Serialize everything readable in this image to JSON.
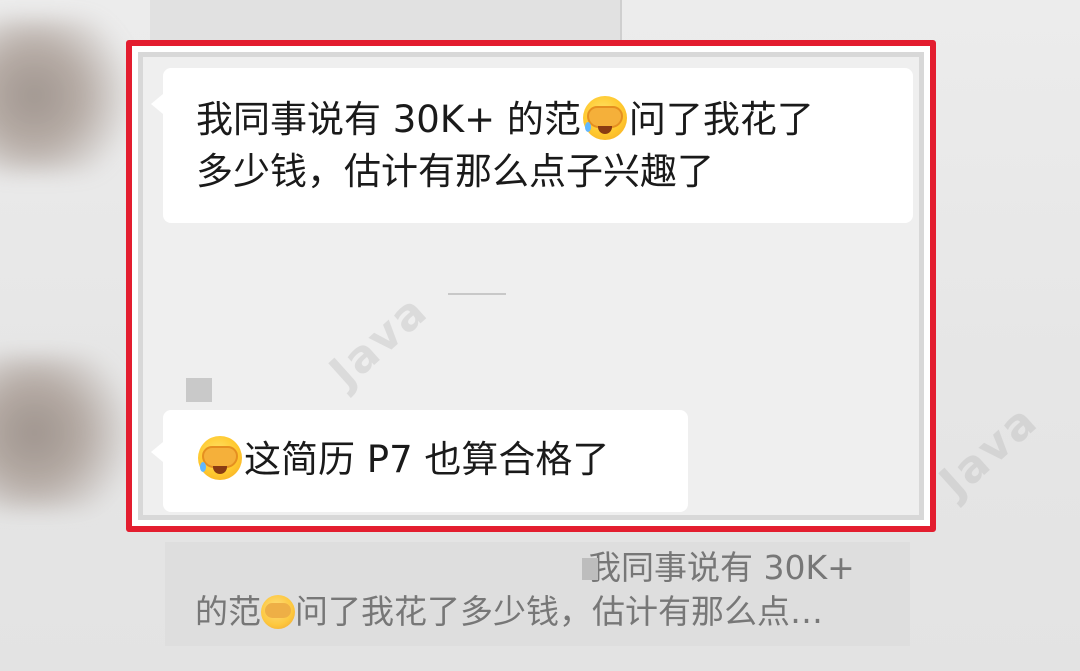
{
  "messages": [
    {
      "text_before_emoji": "我同事说有 30K+ 的范",
      "emoji": "facepalm-emoji",
      "text_after_emoji": "问了我花了",
      "line2": "多少钱，估计有那么点子兴趣了"
    },
    {
      "emoji": "facepalm-emoji",
      "text": "这简历 P7 也算合格了"
    }
  ],
  "quote": {
    "line1": "我同事说有 30K+",
    "line2_prefix": "的范",
    "emoji": "facepalm-emoji",
    "line2_suffix": "问了我花了多少钱，估计有那么点…"
  },
  "watermark": {
    "text": "Java"
  },
  "colors": {
    "highlight_border": "#e31d2f",
    "bubble_bg": "#ffffff",
    "chat_bg": "#efefef",
    "quote_bg": "#dedede"
  }
}
